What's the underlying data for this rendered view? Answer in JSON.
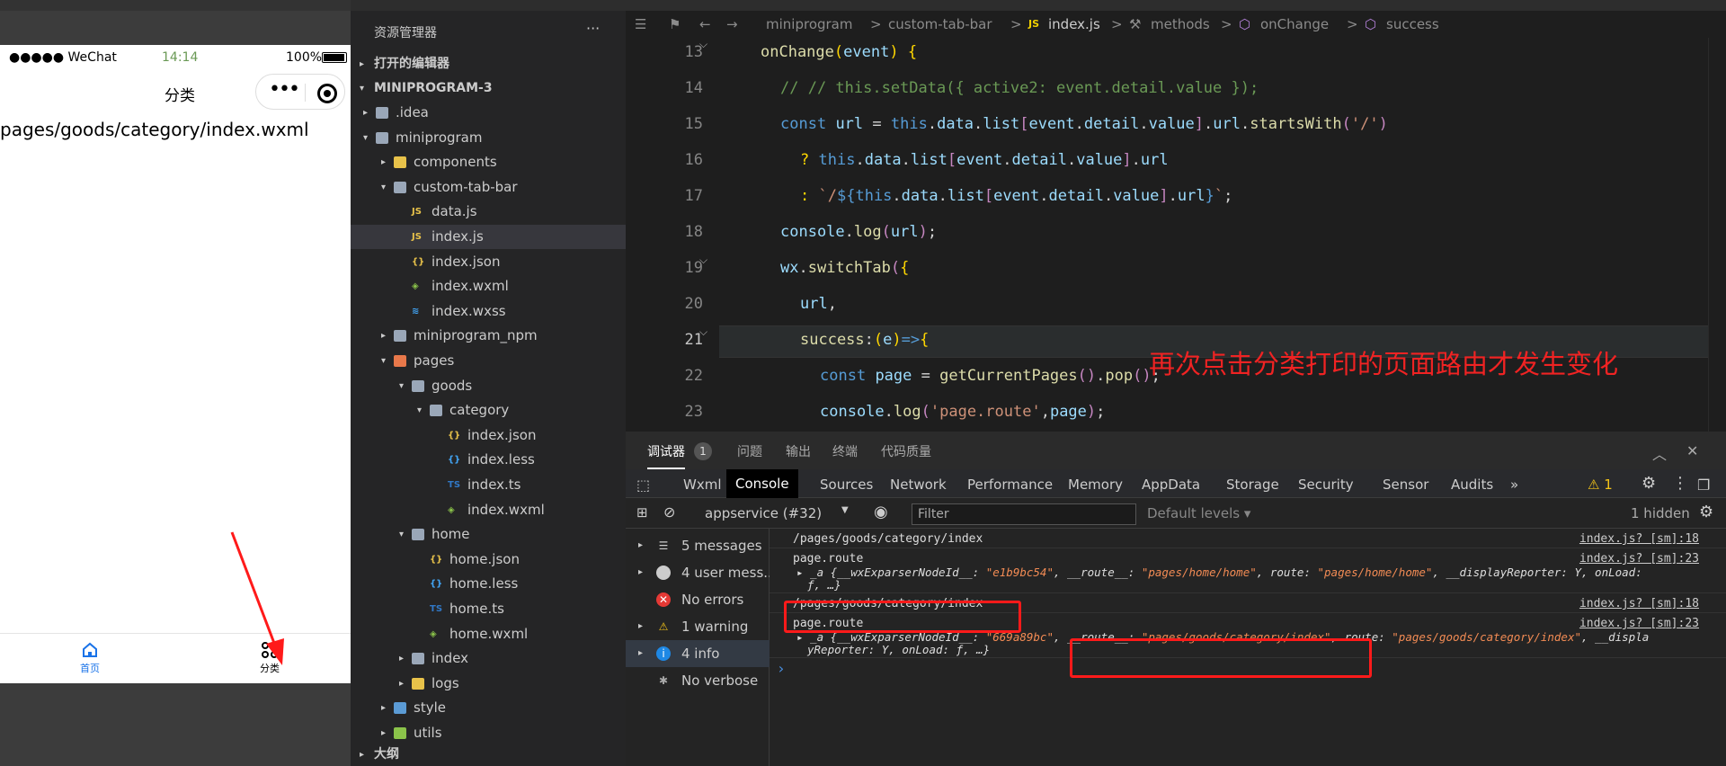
{
  "simulator": {
    "status": {
      "carrier": "●●●●● WeChat",
      "time": "14:14",
      "battery": "100%"
    },
    "nav_title": "分类",
    "capsule_dots": "•••",
    "page_path": "pages/goods/category/index.wxml",
    "tabbar": [
      {
        "label": "首页"
      },
      {
        "label": "分类"
      }
    ]
  },
  "explorer": {
    "title": "资源管理器",
    "more": "···",
    "open_editors": "打开的编辑器",
    "project": "MINIPROGRAM-3",
    "outline": "大纲",
    "items": [
      {
        "label": ".idea",
        "type": "folder",
        "depth": 1,
        "arrow": "▸"
      },
      {
        "label": "miniprogram",
        "type": "folder",
        "depth": 1,
        "arrow": "▾"
      },
      {
        "label": "components",
        "type": "folder-yellow",
        "depth": 2,
        "arrow": "▸"
      },
      {
        "label": "custom-tab-bar",
        "type": "folder",
        "depth": 2,
        "arrow": "▾"
      },
      {
        "label": "data.js",
        "type": "js",
        "depth": 3,
        "arrow": ""
      },
      {
        "label": "index.js",
        "type": "js",
        "depth": 3,
        "arrow": "",
        "selected": true
      },
      {
        "label": "index.json",
        "type": "json",
        "depth": 3,
        "arrow": ""
      },
      {
        "label": "index.wxml",
        "type": "wxml",
        "depth": 3,
        "arrow": ""
      },
      {
        "label": "index.wxss",
        "type": "wxss",
        "depth": 3,
        "arrow": ""
      },
      {
        "label": "miniprogram_npm",
        "type": "folder",
        "depth": 2,
        "arrow": "▸"
      },
      {
        "label": "pages",
        "type": "folder-red",
        "depth": 2,
        "arrow": "▾"
      },
      {
        "label": "goods",
        "type": "folder",
        "depth": 3,
        "arrow": "▾"
      },
      {
        "label": "category",
        "type": "folder",
        "depth": 4,
        "arrow": "▾"
      },
      {
        "label": "index.json",
        "type": "json",
        "depth": 5,
        "arrow": ""
      },
      {
        "label": "index.less",
        "type": "less",
        "depth": 5,
        "arrow": ""
      },
      {
        "label": "index.ts",
        "type": "ts",
        "depth": 5,
        "arrow": ""
      },
      {
        "label": "index.wxml",
        "type": "wxml",
        "depth": 5,
        "arrow": ""
      },
      {
        "label": "home",
        "type": "folder",
        "depth": 3,
        "arrow": "▾"
      },
      {
        "label": "home.json",
        "type": "json",
        "depth": 4,
        "arrow": ""
      },
      {
        "label": "home.less",
        "type": "less",
        "depth": 4,
        "arrow": ""
      },
      {
        "label": "home.ts",
        "type": "ts",
        "depth": 4,
        "arrow": ""
      },
      {
        "label": "home.wxml",
        "type": "wxml",
        "depth": 4,
        "arrow": ""
      },
      {
        "label": "index",
        "type": "folder",
        "depth": 3,
        "arrow": "▸"
      },
      {
        "label": "logs",
        "type": "folder-yellow",
        "depth": 3,
        "arrow": "▸"
      },
      {
        "label": "style",
        "type": "folder-blue",
        "depth": 2,
        "arrow": "▸"
      },
      {
        "label": "utils",
        "type": "folder-green",
        "depth": 2,
        "arrow": "▸"
      }
    ]
  },
  "editor": {
    "breadcrumb": [
      "miniprogram",
      ">",
      "custom-tab-bar",
      ">",
      "index.js",
      ">",
      "methods",
      ">",
      "onChange",
      ">",
      "success"
    ],
    "lines": [
      13,
      14,
      15,
      16,
      17,
      18,
      19,
      20,
      21,
      22,
      23
    ],
    "annotation": "再次点击分类打印的页面路由才发生变化"
  },
  "devtools": {
    "tabs": [
      "调试器",
      "问题",
      "输出",
      "终端",
      "代码质量"
    ],
    "badge": "1",
    "panels": [
      "Wxml",
      "Console",
      "Sources",
      "Network",
      "Performance",
      "Memory",
      "AppData",
      "Storage",
      "Security",
      "Sensor",
      "Audits",
      "»"
    ],
    "warning_count": "⚠ 1",
    "context": "appservice (#32)",
    "filter_placeholder": "Filter",
    "levels": "Default levels ▾",
    "hidden": "1 hidden",
    "sidebar": [
      {
        "label": "5 messages",
        "arrow": "▸"
      },
      {
        "label": "4 user mess...",
        "arrow": "▸"
      },
      {
        "label": "No errors",
        "arrow": ""
      },
      {
        "label": "1 warning",
        "arrow": "▸"
      },
      {
        "label": "4 info",
        "arrow": "▸"
      },
      {
        "label": "No verbose",
        "arrow": ""
      }
    ],
    "messages": [
      {
        "text": "/pages/goods/category/index",
        "source": "index.js? [sm]:18"
      },
      {
        "text": "page.route",
        "source": "index.js? [sm]:23",
        "detail_prefix": "▸ _a {__wxExparserNodeId__: ",
        "node_id": "\"e1b9bc54\"",
        "route_key": ", __route__: ",
        "route_val": "\"pages/home/home\"",
        "route2_key": ", route: ",
        "route2_val": "\"pages/home/home\"",
        "tail": ", __displayReporter: Y, onLoad:",
        "tail2": "ƒ, …}"
      },
      {
        "text": "/pages/goods/category/index",
        "source": "index.js? [sm]:18"
      },
      {
        "text": "page.route",
        "source": "index.js? [sm]:23",
        "detail_prefix": "▸ _a {__wxExparserNodeId__: ",
        "node_id": "\"669a89bc\"",
        "route_key": ", __route__: ",
        "route_val": "\"pages/goods/category/index\"",
        "route2_key": ", route: ",
        "route2_val": "\"pages/goods/category/index\"",
        "tail": ", __displa",
        "tail2": "yReporter: Y, onLoad: ƒ, …}"
      }
    ],
    "prompt": "›"
  }
}
